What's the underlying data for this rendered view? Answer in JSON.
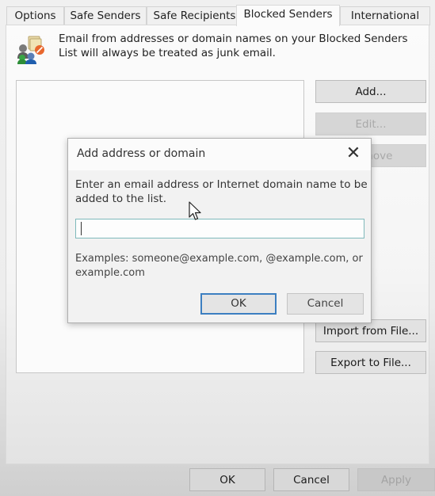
{
  "tabs": [
    {
      "label": "Options",
      "active": false
    },
    {
      "label": "Safe Senders",
      "active": false
    },
    {
      "label": "Safe Recipients",
      "active": false
    },
    {
      "label": "Blocked Senders",
      "active": true
    },
    {
      "label": "International",
      "active": false
    }
  ],
  "panel": {
    "icon": "blocked-senders-icon",
    "description": "Email from addresses or domain names on your Blocked Senders List will always be treated as junk email.",
    "list_items": [],
    "buttons": {
      "add": "Add...",
      "edit": "Edit...",
      "remove": "Remove",
      "import": "Import from File...",
      "export": "Export to File..."
    }
  },
  "footer": {
    "ok": "OK",
    "cancel": "Cancel",
    "apply": "Apply"
  },
  "modal": {
    "title": "Add address or domain",
    "close_icon": "close-icon",
    "prompt": "Enter an email address or Internet domain name to be added to the list.",
    "input_value": "",
    "examples": "Examples: someone@example.com, @example.com, or example.com",
    "ok": "OK",
    "cancel": "Cancel"
  },
  "colors": {
    "focus_border": "#3c7fc1",
    "input_border": "#7fb9bb"
  }
}
